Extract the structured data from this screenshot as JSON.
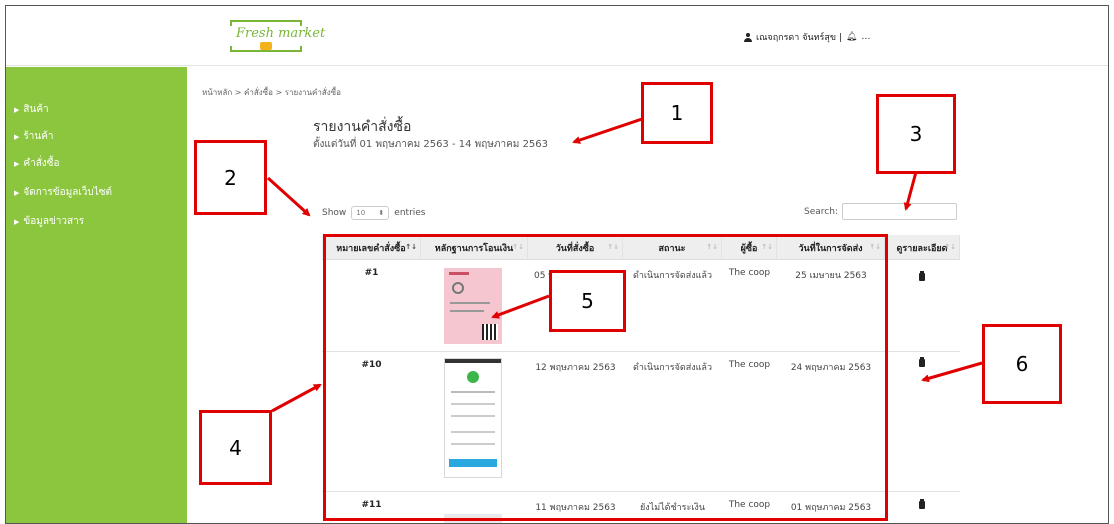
{
  "header": {
    "logo_text": "Fresh market",
    "user_name": "เณจฤกรดา จันทร์สุข |",
    "more_icon": "…"
  },
  "sidebar": {
    "items": [
      {
        "label": "สินค้า"
      },
      {
        "label": "ร้านค้า"
      },
      {
        "label": "คำสั่งซื้อ"
      },
      {
        "label": "จัดการข้อมูลเว็บไซต์"
      },
      {
        "label": "ข้อมูลข่าวสาร"
      }
    ]
  },
  "breadcrumb": "หน้าหลัก > คำสั่งซื้อ > รายงานคำสั่งซื้อ",
  "report": {
    "title": "รายงานคำสั่งซื้อ",
    "date_range": "ตั้งแต่วันที่ 01 พฤษภาคม 2563 - 14 พฤษภาคม 2563"
  },
  "controls": {
    "show_label": "Show",
    "entries_value": "10",
    "entries_label": "entries",
    "search_label": "Search:",
    "search_placeholder": ""
  },
  "table": {
    "columns": [
      "หมายเลขคำสั่งซื้อ",
      "หลักฐานการโอนเงิน",
      "วันที่สั่งซื้อ",
      "สถานะ",
      "ผู้ซื้อ",
      "วันที่ในการจัดส่ง",
      "ดูรายละเอียด"
    ],
    "rows": [
      {
        "order_no": "#1",
        "order_date": "05 พ",
        "status": "ดำเนินการจัดส่งแล้ว",
        "buyer": "The coop",
        "delivery_date": "25 เมษายน 2563"
      },
      {
        "order_no": "#10",
        "order_date": "12 พฤษภาคม 2563",
        "status": "ดำเนินการจัดส่งแล้ว",
        "buyer": "The coop",
        "delivery_date": "24 พฤษภาคม 2563"
      },
      {
        "order_no": "#11",
        "order_date": "11 พฤษภาคม 2563",
        "status": "ยังไม่ได้ชำระเงิน",
        "buyer": "The coop",
        "delivery_date": "01 พฤษภาคม 2563"
      }
    ]
  },
  "callouts": [
    "1",
    "2",
    "3",
    "4",
    "5",
    "6"
  ],
  "colors": {
    "sidebar": "#8cc63f",
    "annotation": "#e00000",
    "header_row": "#eeeeee"
  }
}
